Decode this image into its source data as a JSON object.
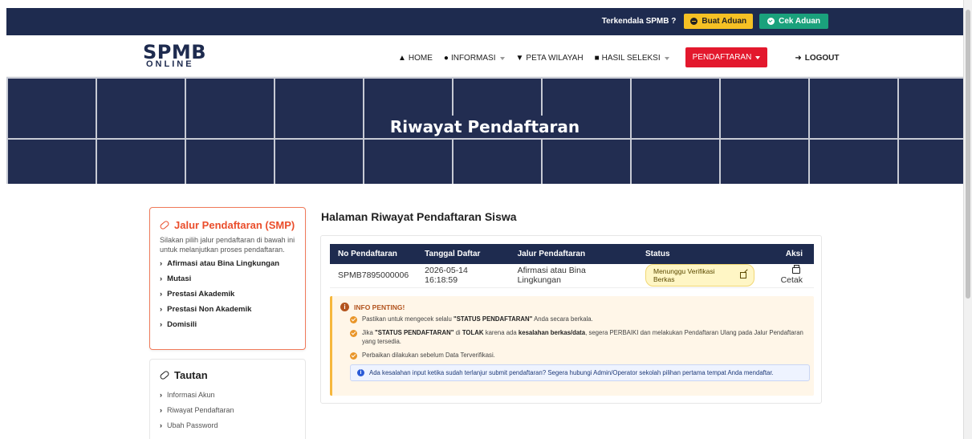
{
  "topbar": {
    "question": "Terkendala SPMB ?",
    "buat_aduan": "Buat Aduan",
    "cek_aduan": "Cek Aduan"
  },
  "logo": {
    "line1": "SPMB",
    "line2": "ONLINE"
  },
  "nav": {
    "home": "HOME",
    "informasi": "INFORMASI",
    "peta": "PETA WILAYAH",
    "hasil": "HASIL SELEKSI",
    "pendaftaran": "PENDAFTARAN",
    "logout": "LOGOUT"
  },
  "hero": {
    "title": "Riwayat Pendaftaran"
  },
  "sidebar": {
    "jalur_title": "Jalur Pendaftaran (SMP)",
    "jalur_desc": "Silakan pilih jalur pendaftaran di bawah ini untuk melanjutkan proses pendaftaran.",
    "jalur_items": [
      "Afirmasi atau Bina Lingkungan",
      "Mutasi",
      "Prestasi Akademik",
      "Prestasi Non Akademik",
      "Domisili"
    ],
    "tautan_title": "Tautan",
    "tautan_items": [
      "Informasi Akun",
      "Riwayat Pendaftaran",
      "Ubah Password"
    ]
  },
  "main": {
    "title": "Halaman Riwayat Pendaftaran Siswa",
    "table": {
      "headers": [
        "No Pendaftaran",
        "Tanggal Daftar",
        "Jalur Pendaftaran",
        "Status",
        "Aksi"
      ],
      "rows": [
        {
          "no": "SPMB7895000006",
          "tanggal": "2026-05-14 16:18:59",
          "jalur": "Afirmasi atau Bina Lingkungan",
          "status": "Menunggu Verifikasi Berkas",
          "aksi": "Cetak"
        }
      ]
    },
    "info": {
      "head": "INFO PENTING!",
      "item1_a": "Pastikan untuk mengecek selalu ",
      "item1_b": "\"STATUS PENDAFTARAN\"",
      "item1_c": " Anda secara berkala.",
      "item2_a": "Jika ",
      "item2_b": "\"STATUS PENDAFTARAN\"",
      "item2_c": " di ",
      "item2_d": "TOLAK",
      "item2_e": " karena ada ",
      "item2_f": "kesalahan berkas/data",
      "item2_g": ", segera PERBAIKI dan melakukan Pendaftaran Ulang pada Jalur Pendaftaran yang tersedia.",
      "item3": "Perbaikan dilakukan sebelum Data Terverifikasi.",
      "note": "Ada kesalahan input ketika sudah terlanjur submit pendaftaran? Segera hubungi Admin/Operator sekolah pilihan pertama tempat Anda mendaftar."
    }
  },
  "colors": {
    "navy": "#1e2b4f",
    "accent_red": "#e3182d",
    "warn": "#f6c124",
    "success": "#1aa17c",
    "orange": "#ea4e2c"
  }
}
